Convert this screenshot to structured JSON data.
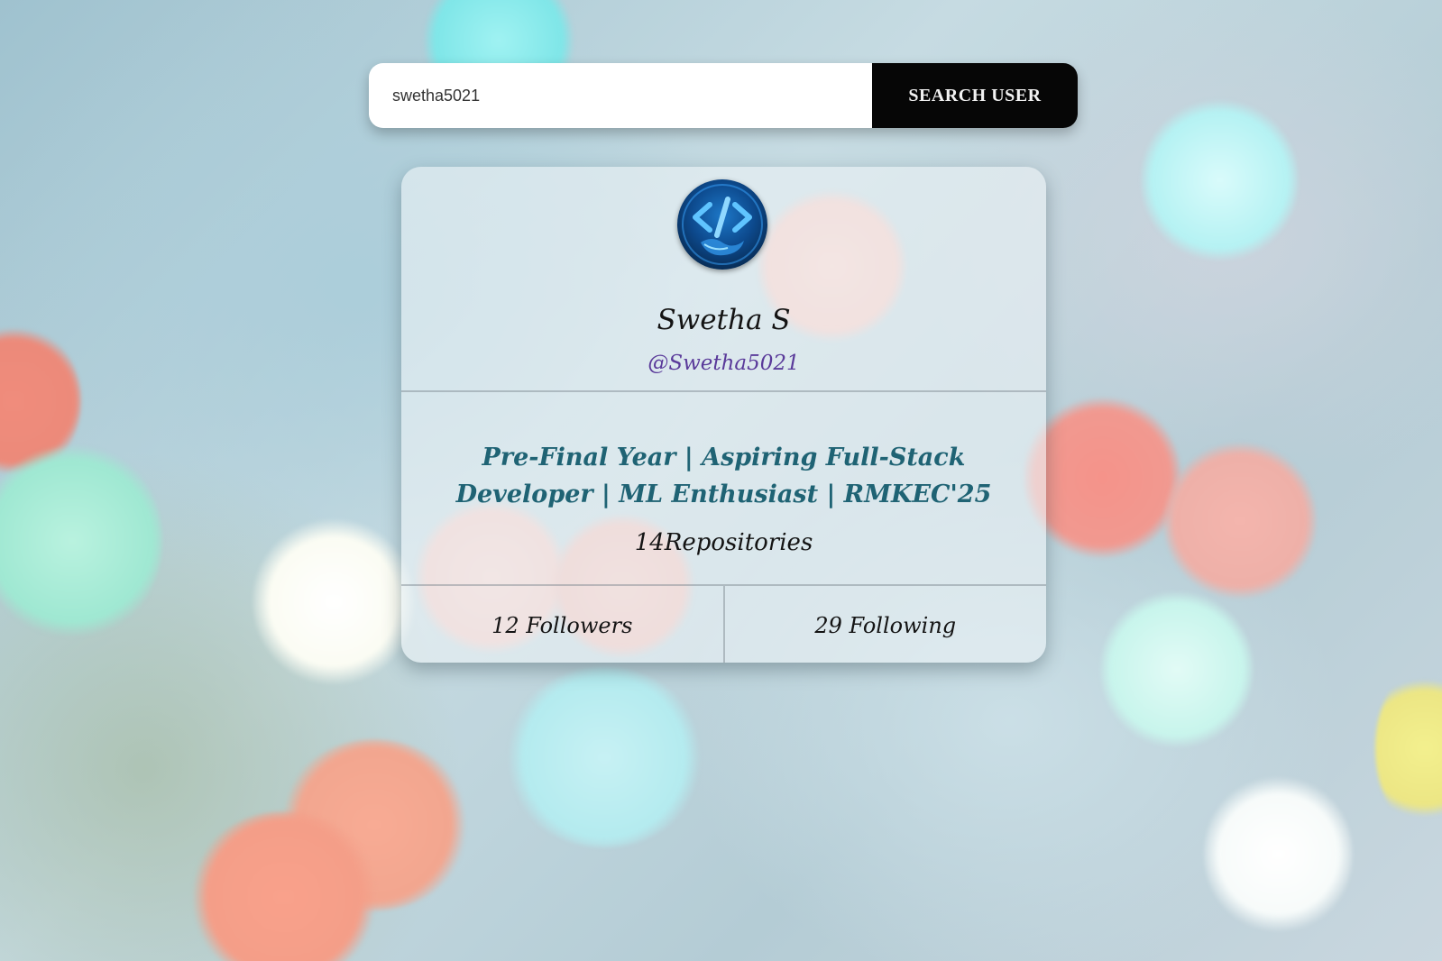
{
  "search": {
    "value": "swetha5021",
    "button_label": "SEARCH USER"
  },
  "profile": {
    "name": "Swetha S",
    "username": "@Swetha5021",
    "bio": "Pre-Final Year | Aspiring Full-Stack Developer | ML Enthusiast | RMKEC'25",
    "repositories": "14Repositories",
    "followers": "12 Followers",
    "following": "29 Following",
    "avatar_icon": "code-brackets-icon"
  },
  "colors": {
    "button_bg": "#060606",
    "username": "#5a3a9a",
    "bio": "#1f6374"
  }
}
